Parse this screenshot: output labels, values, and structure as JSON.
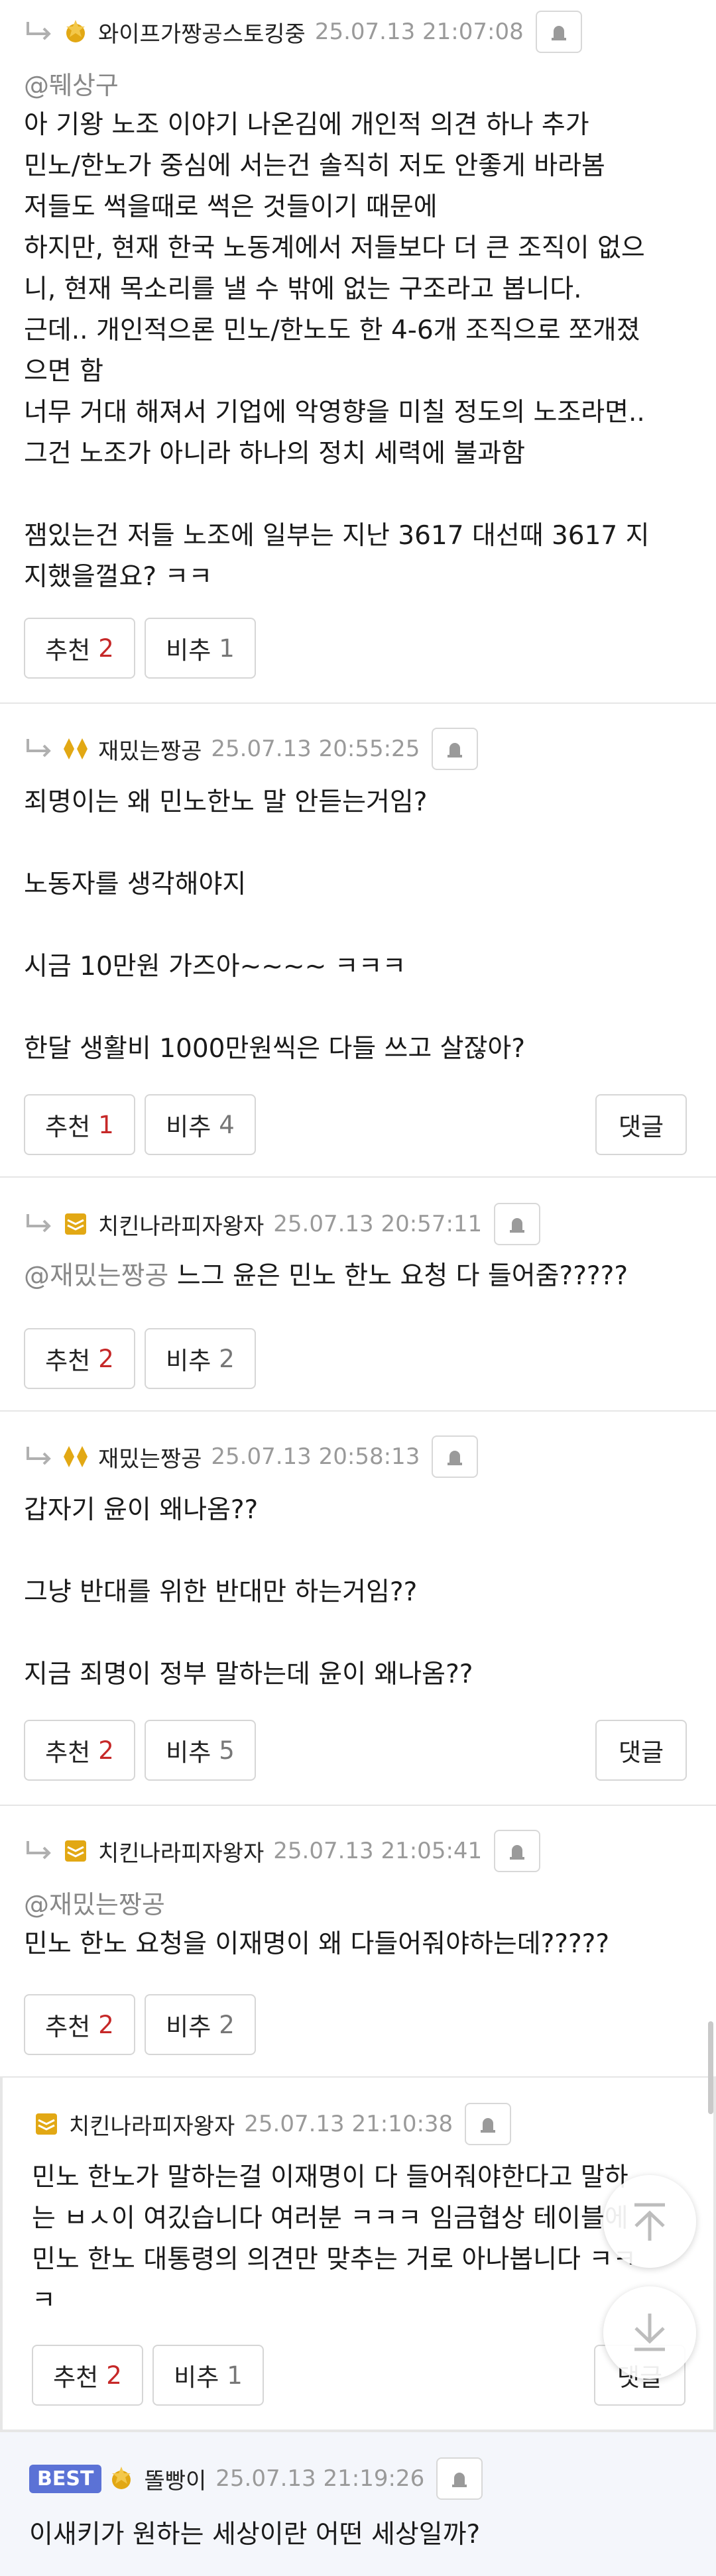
{
  "colors": {
    "upvote": "#c62828",
    "best_badge": "#5b72d6",
    "reply_arrow": "#b0b0b0",
    "grade_gold": "#e2a814"
  },
  "icons": {
    "reply": "reply-arrow-icon",
    "report": "siren-icon",
    "top": "scroll-top-icon",
    "bottom": "scroll-bottom-icon"
  },
  "comments": [
    {
      "nick": "와이프가짱공스토킹중",
      "date": "25.07.13 21:07:08",
      "mention": "@뛔상구",
      "lines": [
        "아 기왕 노조 이야기 나온김에 개인적 의견 하나 추가",
        "민노/한노가 중심에 서는건 솔직히 저도 안좋게 바라봄",
        "저들도 썩을때로 썩은 것들이기 때문에",
        "하지만, 현재 한국 노동계에서 저들보다 더 큰 조직이 없으",
        "니, 현재 목소리를 낼 수 밖에 없는 구조라고 봅니다.",
        "근데.. 개인적으론 민노/한노도 한 4-6개 조직으로 쪼개졌",
        "으면 함",
        "너무 거대 해져서 기업에 악영향을 미칠 정도의 노조라면..",
        "그건 노조가 아니라 하나의 정치 세력에 불과함",
        "",
        "잼있는건 저들 노조에 일부는 지난 3617 대선때 3617 지",
        "지했을껄요? ㅋㅋ"
      ],
      "up_label": "추천",
      "up": "2",
      "down_label": "비추",
      "down": "1"
    },
    {
      "nick": "재밌는짱공",
      "date": "25.07.13 20:55:25",
      "lines": [
        "죄명이는 왜 민노한노 말 안듣는거임?",
        "",
        "노동자를 생각해야지",
        "",
        "시금 10만원 가즈아~~~~ ㅋㅋㅋ",
        "",
        "한달 생활비 1000만원씩은 다들 쓰고 살잖아?"
      ],
      "up_label": "추천",
      "up": "1",
      "down_label": "비추",
      "down": "4",
      "reply_label": "댓글"
    },
    {
      "nick": "치킨나라피자왕자",
      "date": "25.07.13 20:57:11",
      "mention": "@재밌는짱공",
      "text": "느그 윤은 민노 한노 요청 다 들어줌?????",
      "up_label": "추천",
      "up": "2",
      "down_label": "비추",
      "down": "2"
    },
    {
      "nick": "재밌는짱공",
      "date": "25.07.13 20:58:13",
      "lines": [
        "갑자기 윤이 왜나옴??",
        "",
        "그냥 반대를 위한 반대만 하는거임??",
        "",
        "지금 죄명이 정부 말하는데 윤이 왜나옴??"
      ],
      "up_label": "추천",
      "up": "2",
      "down_label": "비추",
      "down": "5",
      "reply_label": "댓글"
    },
    {
      "nick": "치킨나라피자왕자",
      "date": "25.07.13 21:05:41",
      "mention": "@재밌는짱공",
      "lines": [
        "민노 한노 요청을 이재명이 왜 다들어줘야하는데?????"
      ],
      "up_label": "추천",
      "up": "2",
      "down_label": "비추",
      "down": "2"
    },
    {
      "nick": "치킨나라피자왕자",
      "date": "25.07.13 21:10:38",
      "lines": [
        "민노 한노가 말하는걸 이재명이 다 들어줘야한다고 말하",
        "는 ㅂㅅ이 여깄습니다 여러분 ㅋㅋㅋ 임금협상 테이블에",
        "민노 한노 대통령의 의견만 맞추는 거로 아나봅니다 ㅋㅋ",
        "ㅋ"
      ],
      "up_label": "추천",
      "up": "2",
      "down_label": "비추",
      "down": "1",
      "reply_label": "댓글"
    },
    {
      "best": "BEST",
      "nick": "똘빵이",
      "date": "25.07.13 21:19:26",
      "lines": [
        "이새키가 원하는 세상이란 어떤 세상일까?"
      ]
    }
  ]
}
